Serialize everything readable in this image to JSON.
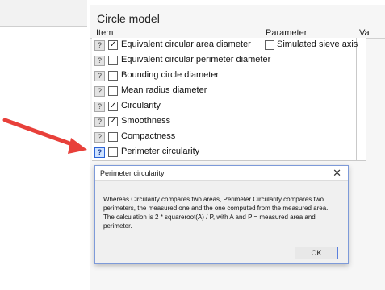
{
  "window": {
    "title": "Circle model"
  },
  "columns": {
    "item": "Item",
    "parameter": "Parameter",
    "value": "Va"
  },
  "rows": [
    {
      "help": "?",
      "checked": true,
      "label": "Equivalent circular area diameter",
      "param_checked": false,
      "param_label": "Simulated sieve axis"
    },
    {
      "help": "?",
      "checked": false,
      "label": "Equivalent circular perimeter diameter",
      "param_checked": null,
      "param_label": ""
    },
    {
      "help": "?",
      "checked": false,
      "label": "Bounding circle diameter",
      "param_checked": null,
      "param_label": ""
    },
    {
      "help": "?",
      "checked": false,
      "label": "Mean radius diameter",
      "param_checked": null,
      "param_label": ""
    },
    {
      "help": "?",
      "checked": true,
      "label": "Circularity",
      "param_checked": null,
      "param_label": ""
    },
    {
      "help": "?",
      "checked": true,
      "label": "Smoothness",
      "param_checked": null,
      "param_label": ""
    },
    {
      "help": "?",
      "checked": false,
      "label": "Compactness",
      "param_checked": null,
      "param_label": ""
    },
    {
      "help": "?",
      "checked": false,
      "label": "Perimeter circularity",
      "param_checked": null,
      "param_label": "",
      "active_help": true
    }
  ],
  "dialog": {
    "title": "Perimeter circularity",
    "close_glyph": "✕",
    "message": "Whereas Circularity compares two areas, Perimeter Circularity compares two perimeters,  the measured one and the one computed from the measured area. The calculation is 2 * squareroot(A) / P, with A and P = measured area and perimeter.",
    "ok_label": "OK"
  },
  "icons": {
    "checkmark": "✓"
  },
  "colors": {
    "arrow": "#e8403a",
    "dialog_border": "#7d9ad9",
    "active_help": "#2b63d6"
  }
}
